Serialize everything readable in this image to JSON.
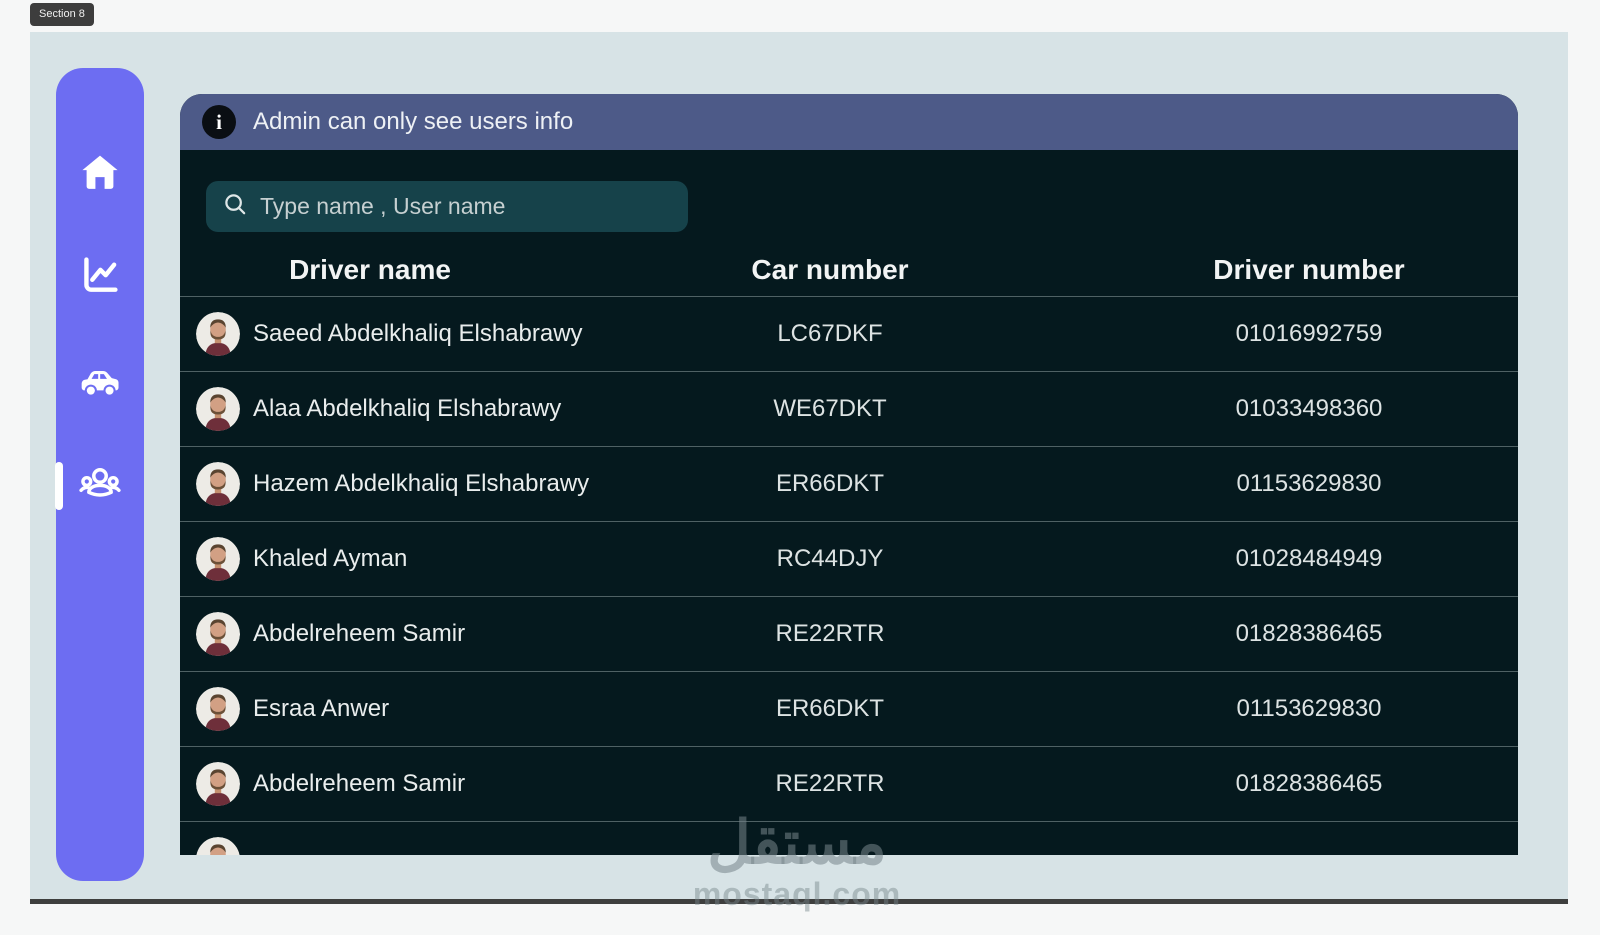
{
  "page": {
    "section_label": "Section 8"
  },
  "sidebar": {
    "items": [
      {
        "id": "home",
        "icon": "home-icon",
        "active": false
      },
      {
        "id": "analytics",
        "icon": "chart-icon",
        "active": false
      },
      {
        "id": "cars",
        "icon": "car-icon",
        "active": false
      },
      {
        "id": "users",
        "icon": "users-icon",
        "active": true
      }
    ]
  },
  "banner": {
    "icon": "info-icon",
    "text": "Admin can only see users info"
  },
  "search": {
    "icon": "search-icon",
    "placeholder": "Type name , User name",
    "value": ""
  },
  "table": {
    "columns": [
      "Driver name",
      "Car number",
      "Driver number"
    ],
    "rows": [
      {
        "driver_name": "Saeed Abdelkhaliq Elshabrawy",
        "car_number": "LC67DKF",
        "driver_number": "01016992759"
      },
      {
        "driver_name": "Alaa Abdelkhaliq Elshabrawy",
        "car_number": "WE67DKT",
        "driver_number": "01033498360"
      },
      {
        "driver_name": "Hazem Abdelkhaliq Elshabrawy",
        "car_number": "ER66DKT",
        "driver_number": "01153629830"
      },
      {
        "driver_name": "Khaled Ayman",
        "car_number": "RC44DJY",
        "driver_number": "01028484949"
      },
      {
        "driver_name": "Abdelreheem Samir",
        "car_number": "RE22RTR",
        "driver_number": "01828386465"
      },
      {
        "driver_name": "Esraa Anwer",
        "car_number": "ER66DKT",
        "driver_number": "01153629830"
      },
      {
        "driver_name": "Abdelreheem Samir",
        "car_number": "RE22RTR",
        "driver_number": "01828386465"
      },
      {
        "driver_name": "",
        "car_number": "",
        "driver_number": ""
      }
    ]
  },
  "watermark": {
    "arabic": "مستقل",
    "domain": "mostaql.com"
  },
  "colors": {
    "canvas": "#d7e3e6",
    "sidebar": "#6d6df2",
    "banner": "#4d5a88",
    "panel": "#05191e",
    "search_box": "#16424a",
    "separator": "#4f6164",
    "bottom_bar": "#3e3f3e"
  }
}
